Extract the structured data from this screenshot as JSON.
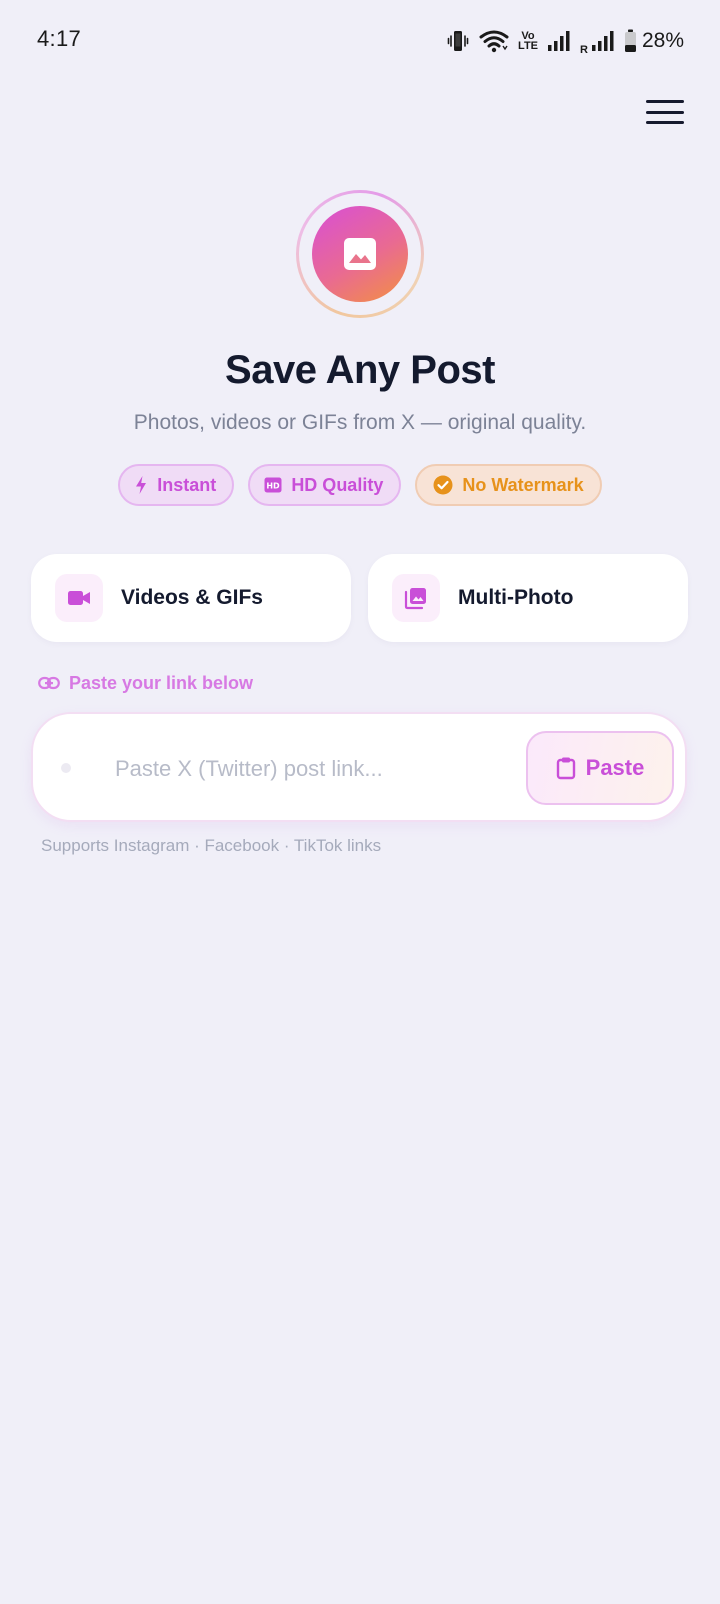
{
  "status_bar": {
    "time": "4:17",
    "volte_top": "Vo",
    "volte_bottom": "LTE",
    "roaming": "R",
    "battery": "28%",
    "icons": [
      "vibrate-icon",
      "wifi-icon",
      "volte-icon",
      "signal-icon",
      "signal-roaming-icon",
      "battery-icon"
    ]
  },
  "header": {
    "menu_icon": "hamburger-menu-icon"
  },
  "hero": {
    "logo_icon": "image-icon",
    "title": "Save Any Post",
    "subtitle": "Photos, videos or GIFs from X — original quality."
  },
  "badges": [
    {
      "label": "Instant",
      "icon": "bolt-icon"
    },
    {
      "label": "HD Quality",
      "icon": "hd-icon"
    },
    {
      "label": "No Watermark",
      "icon": "check-circle-icon"
    }
  ],
  "modes": [
    {
      "label": "Videos & GIFs",
      "icon": "videocam-icon"
    },
    {
      "label": "Multi-Photo",
      "icon": "photo-library-icon"
    }
  ],
  "input": {
    "hint": "Paste your link below",
    "hint_icon": "link-icon",
    "value": "",
    "placeholder": "Paste X (Twitter) post link...",
    "paste_label": "Paste",
    "paste_icon": "clipboard-icon",
    "supports": "Supports Instagram · Facebook · TikTok links"
  },
  "colors": {
    "background": "#f0eff8",
    "accent_pink": "#c94fd8",
    "accent_orange": "#e7921b",
    "title": "#141a2e",
    "muted": "#7c8296"
  }
}
